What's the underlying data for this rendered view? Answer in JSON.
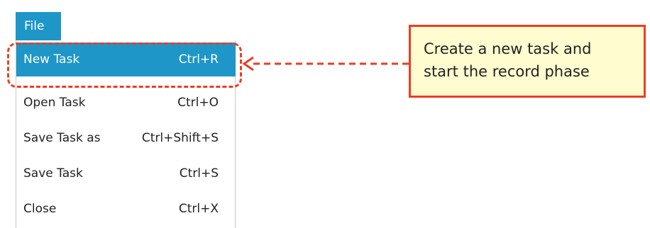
{
  "menu_bar": {
    "file_label": "File"
  },
  "file_menu": {
    "items": [
      {
        "label": "New Task",
        "shortcut": "Ctrl+R",
        "selected": true
      },
      {
        "label": "Open Task",
        "shortcut": "Ctrl+O",
        "selected": false
      },
      {
        "label": "Save Task as",
        "shortcut": "Ctrl+Shift+S",
        "selected": false
      },
      {
        "label": "Save Task",
        "shortcut": "Ctrl+S",
        "selected": false
      },
      {
        "label": "Close",
        "shortcut": "Ctrl+X",
        "selected": false
      }
    ]
  },
  "callout": {
    "line1": "Create a new task and",
    "line2": "start the record phase"
  },
  "colors": {
    "accent": "#1e96c8",
    "annotation": "#ee3d23",
    "note_fill": "#fffdd0"
  },
  "icons": {
    "connector": "left-arrow-icon"
  }
}
